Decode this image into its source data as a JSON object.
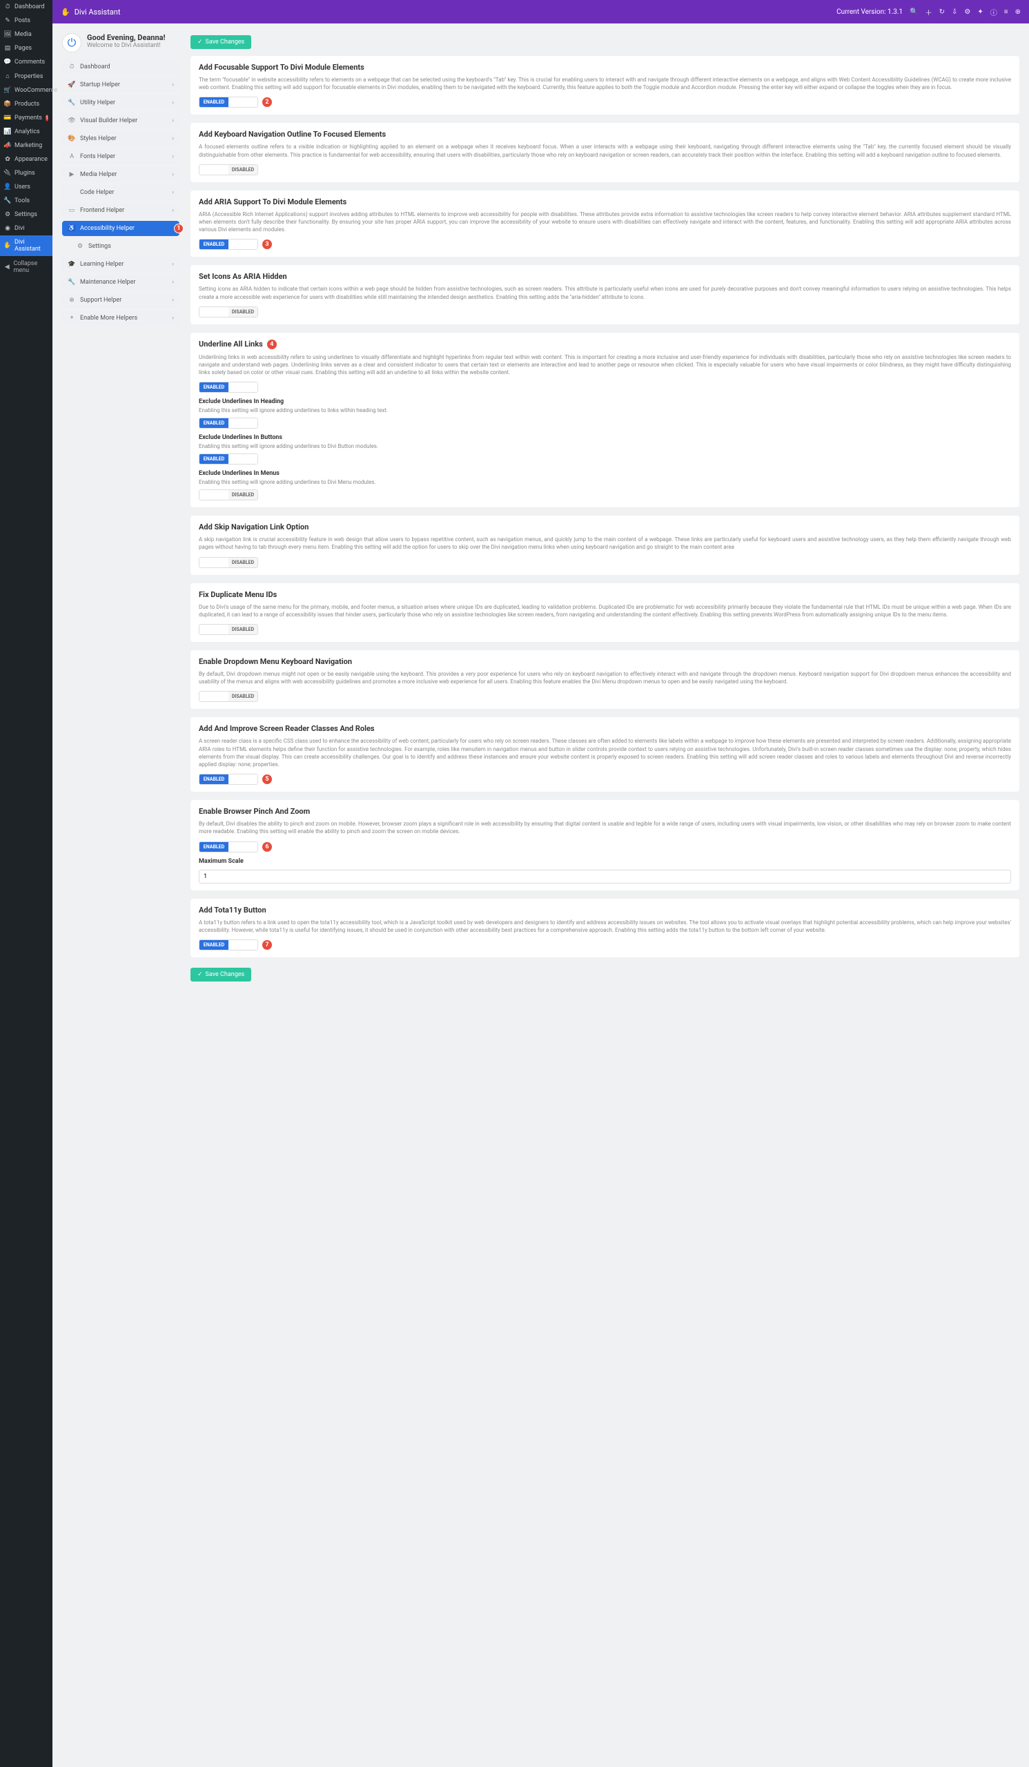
{
  "wp_menu": [
    {
      "icon": "⏱",
      "label": "Dashboard"
    },
    {
      "icon": "✎",
      "label": "Posts"
    },
    {
      "icon": "🖼",
      "label": "Media"
    },
    {
      "icon": "▤",
      "label": "Pages"
    },
    {
      "icon": "💬",
      "label": "Comments"
    },
    {
      "icon": "⌂",
      "label": "Properties"
    },
    {
      "icon": "🛒",
      "label": "WooCommerce"
    },
    {
      "icon": "📦",
      "label": "Products"
    },
    {
      "icon": "💳",
      "label": "Payments",
      "badge": "1"
    },
    {
      "icon": "📊",
      "label": "Analytics"
    },
    {
      "icon": "📣",
      "label": "Marketing"
    },
    {
      "icon": "✿",
      "label": "Appearance"
    },
    {
      "icon": "🔌",
      "label": "Plugins"
    },
    {
      "icon": "👤",
      "label": "Users"
    },
    {
      "icon": "🔧",
      "label": "Tools"
    },
    {
      "icon": "⚙",
      "label": "Settings"
    },
    {
      "icon": "◉",
      "label": "Divi"
    },
    {
      "icon": "✋",
      "label": "Divi Assistant",
      "active": true
    },
    {
      "icon": "◀",
      "label": "Collapse menu",
      "collapse": true
    }
  ],
  "topbar": {
    "brand": "Divi Assistant",
    "version_label": "Current Version:",
    "version": "1.3.1"
  },
  "greeting": {
    "title": "Good Evening, Deanna!",
    "subtitle": "Welcome to Divi Assistant!"
  },
  "helpers": [
    {
      "icon": "⏱",
      "label": "Dashboard"
    },
    {
      "icon": "🚀",
      "label": "Startup Helper",
      "chev": true
    },
    {
      "icon": "🔧",
      "label": "Utility Helper",
      "chev": true
    },
    {
      "icon": "👁",
      "label": "Visual Builder Helper",
      "chev": true
    },
    {
      "icon": "🎨",
      "label": "Styles Helper",
      "chev": true
    },
    {
      "icon": "A",
      "label": "Fonts Helper",
      "chev": true
    },
    {
      "icon": "▶",
      "label": "Media Helper",
      "chev": true
    },
    {
      "icon": "</>",
      "label": "Code Helper",
      "chev": true
    },
    {
      "icon": "▭",
      "label": "Frontend Helper",
      "chev": true
    },
    {
      "icon": "♿",
      "label": "Accessibility Helper",
      "active": true,
      "badge": "1"
    },
    {
      "icon": "⚙",
      "label": "Settings",
      "sub": true
    },
    {
      "icon": "🎓",
      "label": "Learning Helper",
      "chev": true
    },
    {
      "icon": "🔧",
      "label": "Maintenance Helper",
      "chev": true
    },
    {
      "icon": "⊕",
      "label": "Support Helper",
      "chev": true
    },
    {
      "icon": "+",
      "label": "Enable More Helpers",
      "chev": true
    }
  ],
  "save_label": "Save Changes",
  "toggle_labels": {
    "on": "ENABLED",
    "off": "DISABLED"
  },
  "sections": [
    {
      "title": "Add Focusable Support To Divi Module Elements",
      "desc": "The term \"focusable\" in website accessibility refers to elements on a webpage that can be selected using the keyboard's \"Tab\" key. This is crucial for enabling users to interact with and navigate through different interactive elements on a webpage, and aligns with Web Content Accessibility Guidelines (WCAG) to create more inclusive web content. Enabling this setting will add support for focusable elements in Divi modules, enabling them to be navigated with the keyboard. Currently, this feature applies to both the Toggle module and Accordion module. Pressing the enter key will either expand or collapse the toggles when they are in focus.",
      "enabled": true,
      "badge": "2"
    },
    {
      "title": "Add Keyboard Navigation Outline To Focused Elements",
      "desc": "A focused elements outline refers to a visible indication or highlighting applied to an element on a webpage when it receives keyboard focus. When a user interacts with a webpage using their keyboard, navigating through different interactive elements using the \"Tab\" key, the currently focused element should be visually distinguishable from other elements. This practice is fundamental for web accessibility, ensuring that users with disabilities, particularly those who rely on keyboard navigation or screen readers, can accurately track their position within the interface. Enabling this setting will add a keyboard navigation outline to focused elements.",
      "enabled": false
    },
    {
      "title": "Add ARIA Support To Divi Module Elements",
      "desc": "ARIA (Accessible Rich Internet Applications) support involves adding attributes to HTML elements to improve web accessibility for people with disabilities. These attributes provide extra information to assistive technologies like screen readers to help convey interactive element behavior. ARIA attributes supplement standard HTML when elements don't fully describe their functionality. By ensuring your site has proper ARIA support, you can improve the accessibility of your website to ensure users with disabilities can effectively navigate and interact with the content, features, and functionality. Enabling this setting will add appropriate ARIA attributes across various Divi elements and modules.",
      "enabled": true,
      "badge": "3"
    },
    {
      "title": "Set Icons As ARIA Hidden",
      "desc": "Setting icons as ARIA hidden to indicate that certain icons within a web page should be hidden from assistive technologies, such as screen readers. This attribute is particularly useful when icons are used for purely decorative purposes and don't convey meaningful information to users relying on assistive technologies. This helps create a more accessible web experience for users with disabilities while still maintaining the intended design aesthetics. Enabling this setting adds the \"aria-hidden\" attribute to icons.",
      "enabled": false
    },
    {
      "title": "Underline All Links",
      "title_badge": "4",
      "desc": "Underlining links in web accessibility refers to using underlines to visually differentiate and highlight hyperlinks from regular text within web content. This is important for creating a more inclusive and user-friendly experience for individuals with disabilities, particularly those who rely on assistive technologies like screen readers to navigate and understand web pages. Underlining links serves as a clear and consistent indicator to users that certain text or elements are interactive and lead to another page or resource when clicked. This is especially valuable for users who have visual impairments or color blindness, as they might have difficulty distinguishing links solely based on color or other visual cues. Enabling this setting will add an underline to all links within the website content.",
      "enabled": true,
      "subs": [
        {
          "title": "Exclude Underlines In Heading",
          "desc": "Enabling this setting will ignore adding underlines to links within heading text.",
          "enabled": true
        },
        {
          "title": "Exclude Underlines In Buttons",
          "desc": "Enabling this setting will ignore adding underlines to Divi Button modules.",
          "enabled": true
        },
        {
          "title": "Exclude Underlines In Menus",
          "desc": "Enabling this setting will ignore adding underlines to Divi Menu modules.",
          "enabled": false
        }
      ]
    },
    {
      "title": "Add Skip Navigation Link Option",
      "desc": "A skip navigation link is crucial accessibility feature in web design that allow users to bypass repetitive content, such as navigation menus, and quickly jump to the main content of a webpage. These links are particularly useful for keyboard users and assistive technology users, as they help them efficiently navigate through web pages without having to tab through every menu item. Enabling this setting will add the option for users to skip over the Divi navigation menu links when using keyboard navigation and go straight to the main content area",
      "enabled": false
    },
    {
      "title": "Fix Duplicate Menu IDs",
      "desc": "Due to Divi's usage of the same menu for the primary, mobile, and footer menus, a situation arises where unique IDs are duplicated, leading to validation problems. Duplicated IDs are problematic for web accessibility primarily because they violate the fundamental rule that HTML IDs must be unique within a web page. When IDs are duplicated, it can lead to a range of accessibility issues that hinder users, particularly those who rely on assistive technologies like screen readers, from navigating and understanding the content effectively. Enabling this setting prevents WordPress from automatically assigning unique IDs to the menu items.",
      "enabled": false
    },
    {
      "title": "Enable Dropdown Menu Keyboard Navigation",
      "desc": "By default, Divi dropdown menus might not open or be easily navigable using the keyboard. This provides a very poor experience for users who rely on keyboard navigation to effectively interact with and navigate through the dropdown menus. Keyboard navigation support for Divi dropdown menus enhances the accessibility and usability of the menus and aligns with web accessibility guidelines and promotes a more inclusive web experience for all users. Enabling this feature enables the Divi Menu dropdown menus to open and be easily navigated using the keyboard.",
      "enabled": false
    },
    {
      "title": "Add And Improve Screen Reader Classes And Roles",
      "desc": "A screen reader class is a specific CSS class used to enhance the accessibility of web content, particularly for users who rely on screen readers. These classes are often added to elements like labels within a webpage to improve how these elements are presented and interpreted by screen readers. Additionally, assigning appropriate ARIA roles to HTML elements helps define their function for assistive technologies. For example, roles like menuitem in navigation menus and button in slider controls provide context to users relying on assistive technologies. Unfortunately, Divi's built-in screen reader classes sometimes use the display: none; property, which hides elements from the visual display. This can create accessibility challenges. Our goal is to identify and address these instances and ensure your website content is properly exposed to screen readers. Enabling this setting will add screen reader classes and roles to various labels and elements throughout Divi and reverse incorrectly applied display: none; properties.",
      "enabled": true,
      "badge": "5"
    },
    {
      "title": "Enable Browser Pinch And Zoom",
      "desc": "By default, Divi disables the ability to pinch and zoom on mobile. However, browser zoom plays a significant role in web accessibility by ensuring that digital content is usable and legible for a wide range of users, including users with visual impairments, low vision, or other disabilities who may rely on browser zoom to make content more readable. Enabling this setting will enable the ability to pinch and zoom the screen on mobile devices.",
      "enabled": true,
      "badge": "6",
      "field": {
        "label": "Maximum Scale",
        "value": "1"
      }
    },
    {
      "title": "Add Tota11y Button",
      "desc": "A tota11y button refers to a link used to open the tota11y accessibility tool, which is a JavaScript toolkit used by web developers and designers to identify and address accessibility issues on websites. The tool allows you to activate visual overlays that highlight potential accessibility problems, which can help improve your websites' accessibility. However, while tota11y is useful for identifying issues, it should be used in conjunction with other accessibility best practices for a comprehensive approach. Enabling this setting adds the tota11y button to the bottom left corner of your website.",
      "enabled": true,
      "badge": "7"
    }
  ]
}
